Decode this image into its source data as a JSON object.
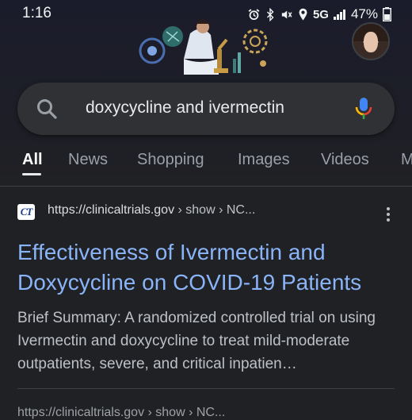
{
  "status_bar": {
    "time": "1:16",
    "network": "5G",
    "battery": "47%"
  },
  "doodle": {
    "icon": "google-doodle-scientist"
  },
  "avatar": {
    "icon": "user-avatar"
  },
  "search": {
    "query": "doxycycline and ivermectin",
    "search_icon": "search-icon",
    "mic_icon": "mic-icon"
  },
  "tabs": [
    {
      "label": "All",
      "active": true
    },
    {
      "label": "News"
    },
    {
      "label": "Shopping"
    },
    {
      "label": "Images"
    },
    {
      "label": "Videos"
    },
    {
      "label": "M"
    }
  ],
  "result": {
    "favicon_text": "CT",
    "url_domain": "https://clinicaltrials.gov",
    "url_path": " › show › NC...",
    "title": "Effectiveness of Ivermectin and Doxycycline on COVID-19 Patients",
    "snippet": "Brief Summary: A randomized controlled trial on using Ivermectin and doxycycline to treat mild-moderate outpatients, severe, and critical inpatien…"
  },
  "next_result": {
    "url": "https://clinicaltrials.gov › show › NC..."
  },
  "colors": {
    "background": "#202124",
    "link": "#8ab4f8",
    "search_box": "#303134",
    "accent_blue": "#4285f4"
  }
}
